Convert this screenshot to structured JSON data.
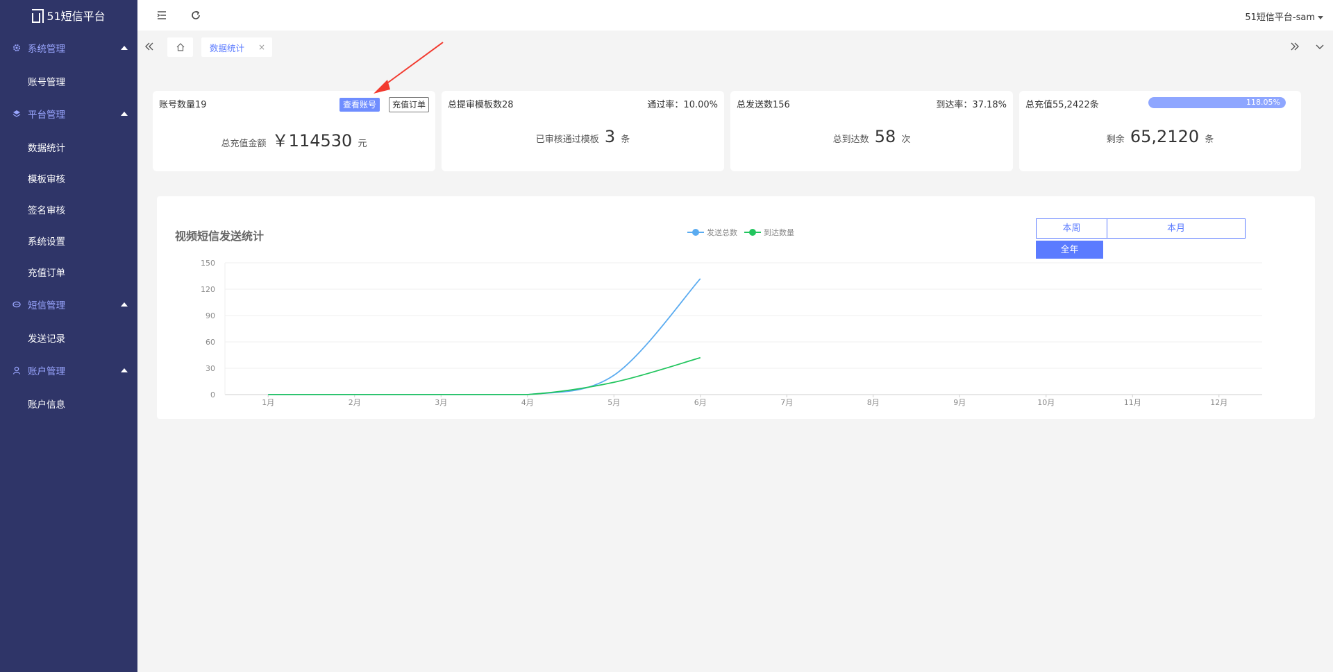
{
  "app": {
    "logo_text": "51短信平台"
  },
  "sidebar": {
    "groups": [
      {
        "label": "系统管理",
        "items": [
          "账号管理"
        ]
      },
      {
        "label": "平台管理",
        "items": [
          "数据统计",
          "模板审核",
          "签名审核",
          "系统设置",
          "充值订单"
        ]
      },
      {
        "label": "短信管理",
        "items": [
          "发送记录"
        ]
      },
      {
        "label": "账户管理",
        "items": [
          "账户信息"
        ]
      }
    ]
  },
  "header": {
    "user": "51短信平台-sam"
  },
  "tabs": {
    "active": "数据统计",
    "close": "×"
  },
  "cards": {
    "accounts": {
      "title": "账号数量19",
      "view_btn": "查看账号",
      "order_btn": "充值订单",
      "main_label": "总充值金额",
      "main_value": "￥114530",
      "main_unit": "元"
    },
    "templates": {
      "title": "总提审模板数28",
      "right": "通过率：10.00%",
      "main_label": "已审核通过模板",
      "main_value": "3",
      "main_unit": "条"
    },
    "sends": {
      "title": "总发送数156",
      "right": "到达率：37.18%",
      "main_label": "总到达数",
      "main_value": "58",
      "main_unit": "次"
    },
    "recharge": {
      "title": "总充值55,2422条",
      "progress_text": "118.05%",
      "progress_value": 1.0,
      "main_label": "剩余",
      "main_value": "65,2120",
      "main_unit": "条"
    }
  },
  "panel": {
    "title": "视频短信发送统计",
    "periods": [
      "本周",
      "本月",
      "全年"
    ],
    "active_period": "全年"
  },
  "chart_data": {
    "type": "line",
    "categories": [
      "1月",
      "2月",
      "3月",
      "4月",
      "5月",
      "6月",
      "7月",
      "8月",
      "9月",
      "10月",
      "11月",
      "12月"
    ],
    "ylim": [
      0,
      150
    ],
    "yticks": [
      0,
      30,
      60,
      90,
      120,
      150
    ],
    "smooth": true,
    "grid": true,
    "legend_position": "top-center",
    "series": [
      {
        "name": "发送总数",
        "color": "#5aabf0",
        "values": [
          0,
          0,
          0,
          0,
          22,
          132
        ]
      },
      {
        "name": "到达数量",
        "color": "#22c55e",
        "values": [
          0,
          0,
          0,
          0,
          14,
          42
        ]
      }
    ]
  },
  "colors": {
    "sidebar_bg": "#2f3568",
    "accent": "#5b7bff",
    "annotation": "#f23a2f"
  }
}
